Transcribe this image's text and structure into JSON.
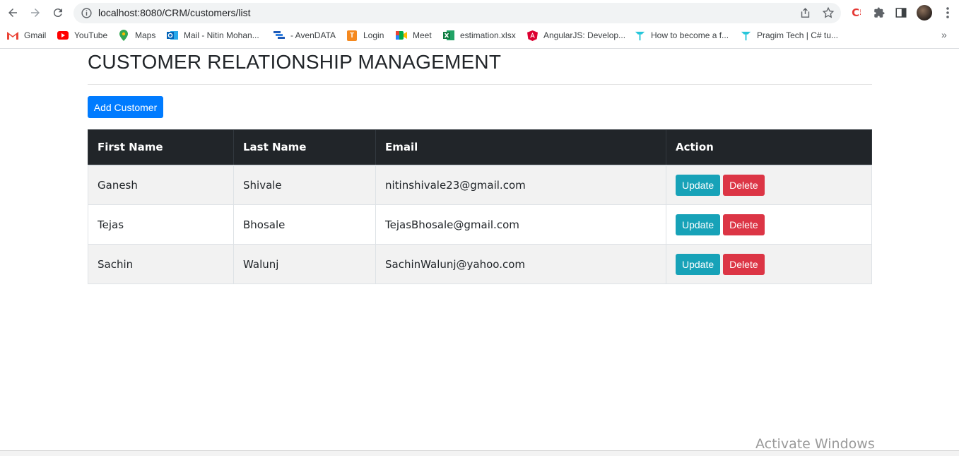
{
  "browser": {
    "url": "localhost:8080/CRM/customers/list",
    "bookmarks": [
      {
        "label": "Gmail",
        "icon": "gmail-icon"
      },
      {
        "label": "YouTube",
        "icon": "youtube-icon"
      },
      {
        "label": "Maps",
        "icon": "maps-icon"
      },
      {
        "label": "Mail - Nitin Mohan...",
        "icon": "outlook-icon"
      },
      {
        "label": "- AvenDATA",
        "icon": "avendata-icon"
      },
      {
        "label": "Login",
        "icon": "login-icon"
      },
      {
        "label": "Meet",
        "icon": "meet-icon"
      },
      {
        "label": "estimation.xlsx",
        "icon": "excel-icon"
      },
      {
        "label": "AngularJS: Develop...",
        "icon": "angular-icon"
      },
      {
        "label": "How to become a f...",
        "icon": "pragim-icon"
      },
      {
        "label": "Pragim Tech | C# tu...",
        "icon": "pragim-icon"
      }
    ],
    "more_label": "»"
  },
  "page": {
    "title": "CUSTOMER RELATIONSHIP MANAGEMENT",
    "add_button_label": "Add Customer"
  },
  "table": {
    "headers": [
      "First Name",
      "Last Name",
      "Email",
      "Action"
    ],
    "rows": [
      {
        "first_name": "Ganesh",
        "last_name": "Shivale",
        "email": "nitinshivale23@gmail.com",
        "update_label": "Update",
        "delete_label": "Delete"
      },
      {
        "first_name": "Tejas",
        "last_name": "Bhosale",
        "email": "TejasBhosale@gmail.com",
        "update_label": "Update",
        "delete_label": "Delete"
      },
      {
        "first_name": "Sachin",
        "last_name": "Walunj",
        "email": "SachinWalunj@yahoo.com",
        "update_label": "Update",
        "delete_label": "Delete"
      }
    ]
  },
  "watermark": "Activate Windows",
  "colors": {
    "primary": "#007bff",
    "info": "#17a2b8",
    "danger": "#dc3545",
    "header_dark": "#212529"
  }
}
